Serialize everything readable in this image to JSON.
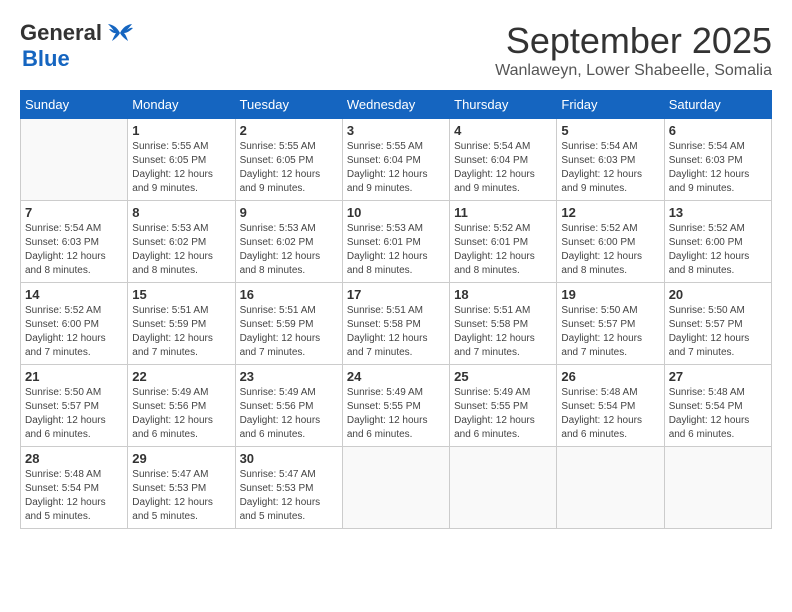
{
  "logo": {
    "line1": "General",
    "line2": "Blue"
  },
  "title": "September 2025",
  "location": "Wanlaweyn, Lower Shabeelle, Somalia",
  "days_of_week": [
    "Sunday",
    "Monday",
    "Tuesday",
    "Wednesday",
    "Thursday",
    "Friday",
    "Saturday"
  ],
  "weeks": [
    [
      {
        "day": "",
        "info": ""
      },
      {
        "day": "1",
        "info": "Sunrise: 5:55 AM\nSunset: 6:05 PM\nDaylight: 12 hours\nand 9 minutes."
      },
      {
        "day": "2",
        "info": "Sunrise: 5:55 AM\nSunset: 6:05 PM\nDaylight: 12 hours\nand 9 minutes."
      },
      {
        "day": "3",
        "info": "Sunrise: 5:55 AM\nSunset: 6:04 PM\nDaylight: 12 hours\nand 9 minutes."
      },
      {
        "day": "4",
        "info": "Sunrise: 5:54 AM\nSunset: 6:04 PM\nDaylight: 12 hours\nand 9 minutes."
      },
      {
        "day": "5",
        "info": "Sunrise: 5:54 AM\nSunset: 6:03 PM\nDaylight: 12 hours\nand 9 minutes."
      },
      {
        "day": "6",
        "info": "Sunrise: 5:54 AM\nSunset: 6:03 PM\nDaylight: 12 hours\nand 9 minutes."
      }
    ],
    [
      {
        "day": "7",
        "info": "Sunrise: 5:54 AM\nSunset: 6:03 PM\nDaylight: 12 hours\nand 8 minutes."
      },
      {
        "day": "8",
        "info": "Sunrise: 5:53 AM\nSunset: 6:02 PM\nDaylight: 12 hours\nand 8 minutes."
      },
      {
        "day": "9",
        "info": "Sunrise: 5:53 AM\nSunset: 6:02 PM\nDaylight: 12 hours\nand 8 minutes."
      },
      {
        "day": "10",
        "info": "Sunrise: 5:53 AM\nSunset: 6:01 PM\nDaylight: 12 hours\nand 8 minutes."
      },
      {
        "day": "11",
        "info": "Sunrise: 5:52 AM\nSunset: 6:01 PM\nDaylight: 12 hours\nand 8 minutes."
      },
      {
        "day": "12",
        "info": "Sunrise: 5:52 AM\nSunset: 6:00 PM\nDaylight: 12 hours\nand 8 minutes."
      },
      {
        "day": "13",
        "info": "Sunrise: 5:52 AM\nSunset: 6:00 PM\nDaylight: 12 hours\nand 8 minutes."
      }
    ],
    [
      {
        "day": "14",
        "info": "Sunrise: 5:52 AM\nSunset: 6:00 PM\nDaylight: 12 hours\nand 7 minutes."
      },
      {
        "day": "15",
        "info": "Sunrise: 5:51 AM\nSunset: 5:59 PM\nDaylight: 12 hours\nand 7 minutes."
      },
      {
        "day": "16",
        "info": "Sunrise: 5:51 AM\nSunset: 5:59 PM\nDaylight: 12 hours\nand 7 minutes."
      },
      {
        "day": "17",
        "info": "Sunrise: 5:51 AM\nSunset: 5:58 PM\nDaylight: 12 hours\nand 7 minutes."
      },
      {
        "day": "18",
        "info": "Sunrise: 5:51 AM\nSunset: 5:58 PM\nDaylight: 12 hours\nand 7 minutes."
      },
      {
        "day": "19",
        "info": "Sunrise: 5:50 AM\nSunset: 5:57 PM\nDaylight: 12 hours\nand 7 minutes."
      },
      {
        "day": "20",
        "info": "Sunrise: 5:50 AM\nSunset: 5:57 PM\nDaylight: 12 hours\nand 7 minutes."
      }
    ],
    [
      {
        "day": "21",
        "info": "Sunrise: 5:50 AM\nSunset: 5:57 PM\nDaylight: 12 hours\nand 6 minutes."
      },
      {
        "day": "22",
        "info": "Sunrise: 5:49 AM\nSunset: 5:56 PM\nDaylight: 12 hours\nand 6 minutes."
      },
      {
        "day": "23",
        "info": "Sunrise: 5:49 AM\nSunset: 5:56 PM\nDaylight: 12 hours\nand 6 minutes."
      },
      {
        "day": "24",
        "info": "Sunrise: 5:49 AM\nSunset: 5:55 PM\nDaylight: 12 hours\nand 6 minutes."
      },
      {
        "day": "25",
        "info": "Sunrise: 5:49 AM\nSunset: 5:55 PM\nDaylight: 12 hours\nand 6 minutes."
      },
      {
        "day": "26",
        "info": "Sunrise: 5:48 AM\nSunset: 5:54 PM\nDaylight: 12 hours\nand 6 minutes."
      },
      {
        "day": "27",
        "info": "Sunrise: 5:48 AM\nSunset: 5:54 PM\nDaylight: 12 hours\nand 6 minutes."
      }
    ],
    [
      {
        "day": "28",
        "info": "Sunrise: 5:48 AM\nSunset: 5:54 PM\nDaylight: 12 hours\nand 5 minutes."
      },
      {
        "day": "29",
        "info": "Sunrise: 5:47 AM\nSunset: 5:53 PM\nDaylight: 12 hours\nand 5 minutes."
      },
      {
        "day": "30",
        "info": "Sunrise: 5:47 AM\nSunset: 5:53 PM\nDaylight: 12 hours\nand 5 minutes."
      },
      {
        "day": "",
        "info": ""
      },
      {
        "day": "",
        "info": ""
      },
      {
        "day": "",
        "info": ""
      },
      {
        "day": "",
        "info": ""
      }
    ]
  ]
}
